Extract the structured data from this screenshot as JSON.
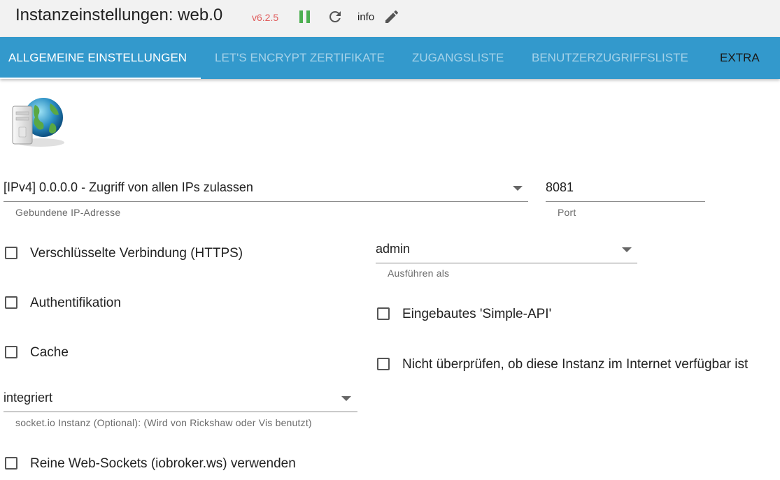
{
  "header": {
    "title": "Instanzeinstellungen: web.0",
    "version": "v6.2.5",
    "info_label": "info",
    "version_color": "#e05c5c",
    "pause_color": "#4caf50"
  },
  "tabs": [
    {
      "label": "ALLGEMEINE EINSTELLUNGEN",
      "active": true
    },
    {
      "label": "LET'S ENCRYPT ZERTIFIKATE",
      "active": false
    },
    {
      "label": "ZUGANGSLISTE",
      "active": false
    },
    {
      "label": "BENUTZERZUGRIFFSLISTE",
      "active": false
    },
    {
      "label": "EXTRA",
      "active": false
    }
  ],
  "tabbar_color": "#3399cc",
  "logo_icon": "server-globe-icon",
  "form": {
    "bind": {
      "value": "[IPv4] 0.0.0.0 - Zugriff von allen IPs zulassen",
      "helper": "Gebundene IP-Adresse"
    },
    "port": {
      "value": "8081",
      "helper": "Port"
    },
    "run_as": {
      "value": "admin",
      "helper": "Ausführen als"
    },
    "socketio": {
      "value": "integriert",
      "helper": "socket.io Instanz (Optional): (Wird von Rickshaw oder Vis benutzt)"
    },
    "checkboxes": {
      "https": {
        "label": "Verschlüsselte Verbindung (HTTPS)",
        "checked": false
      },
      "auth": {
        "label": "Authentifikation",
        "checked": false
      },
      "cache": {
        "label": "Cache",
        "checked": false
      },
      "simple_api": {
        "label": "Eingebautes 'Simple-API'",
        "checked": false
      },
      "no_check": {
        "label": "Nicht überprüfen, ob diese Instanz im Internet verfügbar ist",
        "checked": false
      },
      "pure_ws": {
        "label": "Reine Web-Sockets (iobroker.ws) verwenden",
        "checked": false
      }
    }
  }
}
